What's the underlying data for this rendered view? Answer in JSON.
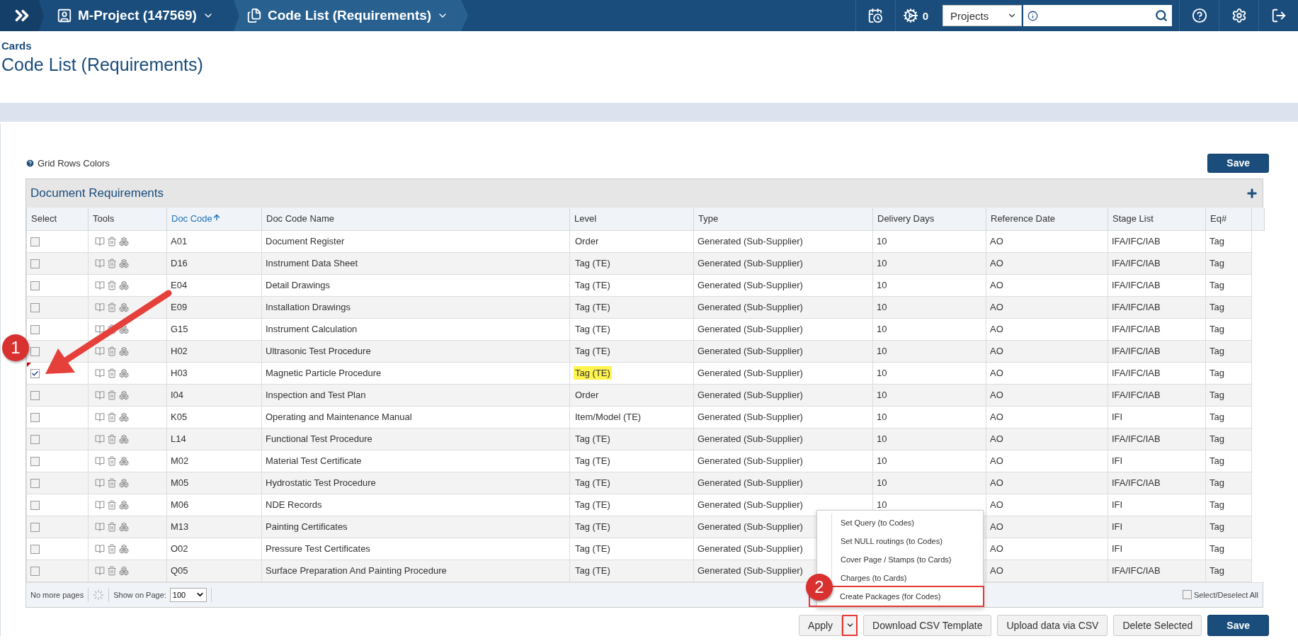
{
  "topbar": {
    "breadcrumbs": [
      {
        "label": "M-Project (147569)",
        "kind": "project"
      },
      {
        "label": "Code List (Requirements)",
        "kind": "page"
      }
    ],
    "jobs_count": "0",
    "search_scope": "Projects"
  },
  "header": {
    "section": "Cards",
    "title": "Code List (Requirements)"
  },
  "grid_colors_link": "Grid Rows Colors",
  "top_save": "Save",
  "grid": {
    "title": "Document Requirements",
    "columns": [
      {
        "label": "Select",
        "sorted": false
      },
      {
        "label": "Tools",
        "sorted": false
      },
      {
        "label": "Doc Code",
        "sorted": true
      },
      {
        "label": "Doc Code Name",
        "sorted": false
      },
      {
        "label": "Level",
        "sorted": false
      },
      {
        "label": "Type",
        "sorted": false
      },
      {
        "label": "Delivery Days",
        "sorted": false
      },
      {
        "label": "Reference Date",
        "sorted": false
      },
      {
        "label": "Stage List",
        "sorted": false
      },
      {
        "label": "Eq#",
        "sorted": false
      }
    ],
    "rows": [
      {
        "checked": false,
        "flagged": false,
        "code": "A01",
        "name": "Document Register",
        "level": "Order",
        "level_highlighted": false,
        "type": "Generated (Sub-Supplier)",
        "delivery_days": "10",
        "reference_date": "AO",
        "stage_list": "IFA/IFC/IAB",
        "eq": "Tag"
      },
      {
        "checked": false,
        "flagged": false,
        "code": "D16",
        "name": "Instrument Data Sheet",
        "level": "Tag (TE)",
        "level_highlighted": false,
        "type": "Generated (Sub-Supplier)",
        "delivery_days": "10",
        "reference_date": "AO",
        "stage_list": "IFA/IFC/IAB",
        "eq": "Tag"
      },
      {
        "checked": false,
        "flagged": false,
        "code": "E04",
        "name": "Detail Drawings",
        "level": "Tag (TE)",
        "level_highlighted": false,
        "type": "Generated (Sub-Supplier)",
        "delivery_days": "10",
        "reference_date": "AO",
        "stage_list": "IFA/IFC/IAB",
        "eq": "Tag"
      },
      {
        "checked": false,
        "flagged": false,
        "code": "E09",
        "name": "Installation Drawings",
        "level": "Tag (TE)",
        "level_highlighted": false,
        "type": "Generated (Sub-Supplier)",
        "delivery_days": "10",
        "reference_date": "AO",
        "stage_list": "IFA/IFC/IAB",
        "eq": "Tag"
      },
      {
        "checked": false,
        "flagged": false,
        "code": "G15",
        "name": "Instrument Calculation",
        "level": "Tag (TE)",
        "level_highlighted": false,
        "type": "Generated (Sub-Supplier)",
        "delivery_days": "10",
        "reference_date": "AO",
        "stage_list": "IFA/IFC/IAB",
        "eq": "Tag"
      },
      {
        "checked": false,
        "flagged": false,
        "code": "H02",
        "name": "Ultrasonic Test Procedure",
        "level": "Tag (TE)",
        "level_highlighted": false,
        "type": "Generated (Sub-Supplier)",
        "delivery_days": "10",
        "reference_date": "AO",
        "stage_list": "IFA/IFC/IAB",
        "eq": "Tag"
      },
      {
        "checked": true,
        "flagged": true,
        "code": "H03",
        "name": "Magnetic Particle Procedure",
        "level": "Tag (TE)",
        "level_highlighted": true,
        "type": "Generated (Sub-Supplier)",
        "delivery_days": "10",
        "reference_date": "AO",
        "stage_list": "IFA/IFC/IAB",
        "eq": "Tag"
      },
      {
        "checked": false,
        "flagged": false,
        "code": "I04",
        "name": "Inspection and Test Plan",
        "level": "Order",
        "level_highlighted": false,
        "type": "Generated (Sub-Supplier)",
        "delivery_days": "10",
        "reference_date": "AO",
        "stage_list": "IFA/IFC/IAB",
        "eq": "Tag"
      },
      {
        "checked": false,
        "flagged": false,
        "code": "K05",
        "name": "Operating and Maintenance Manual",
        "level": "Item/Model (TE)",
        "level_highlighted": false,
        "type": "Generated (Sub-Supplier)",
        "delivery_days": "10",
        "reference_date": "AO",
        "stage_list": "IFI",
        "eq": "Tag"
      },
      {
        "checked": false,
        "flagged": false,
        "code": "L14",
        "name": "Functional Test Procedure",
        "level": "Tag (TE)",
        "level_highlighted": false,
        "type": "Generated (Sub-Supplier)",
        "delivery_days": "10",
        "reference_date": "AO",
        "stage_list": "IFA/IFC/IAB",
        "eq": "Tag"
      },
      {
        "checked": false,
        "flagged": false,
        "code": "M02",
        "name": "Material Test Certificate",
        "level": "Tag (TE)",
        "level_highlighted": false,
        "type": "Generated (Sub-Supplier)",
        "delivery_days": "10",
        "reference_date": "AO",
        "stage_list": "IFI",
        "eq": "Tag"
      },
      {
        "checked": false,
        "flagged": false,
        "code": "M05",
        "name": "Hydrostatic Test Procedure",
        "level": "Tag (TE)",
        "level_highlighted": false,
        "type": "Generated (Sub-Supplier)",
        "delivery_days": "10",
        "reference_date": "AO",
        "stage_list": "IFA/IFC/IAB",
        "eq": "Tag"
      },
      {
        "checked": false,
        "flagged": false,
        "code": "M06",
        "name": "NDE Records",
        "level": "Tag (TE)",
        "level_highlighted": false,
        "type": "Generated (Sub-Supplier)",
        "delivery_days": "10",
        "reference_date": "AO",
        "stage_list": "IFI",
        "eq": "Tag"
      },
      {
        "checked": false,
        "flagged": false,
        "code": "M13",
        "name": "Painting Certificates",
        "level": "Tag (TE)",
        "level_highlighted": false,
        "type": "Generated (Sub-Supplier)",
        "reference_date": "AO",
        "stage_list": "IFI",
        "eq": "Tag"
      },
      {
        "checked": false,
        "flagged": false,
        "code": "O02",
        "name": "Pressure Test Certificates",
        "level": "Tag (TE)",
        "level_highlighted": false,
        "type": "Generated (Sub-Supplier)",
        "reference_date": "AO",
        "stage_list": "IFI",
        "eq": "Tag"
      },
      {
        "checked": false,
        "flagged": false,
        "code": "Q05",
        "name": "Surface Preparation And Painting Procedure",
        "level": "Tag (TE)",
        "level_highlighted": false,
        "type": "Generated (Sub-Supplier)",
        "reference_date": "AO",
        "stage_list": "IFA/IFC/IAB",
        "eq": "Tag"
      }
    ],
    "footer": {
      "paging": "No more pages",
      "page_size_label": "Show on Page:",
      "page_size": "100",
      "select_all_label": "Select/Deselect All",
      "select_all_checked": false
    }
  },
  "apply_menu": {
    "items": [
      {
        "label": "Set Query (to Codes)",
        "framed": false
      },
      {
        "label": "Set NULL routings (to Codes)",
        "framed": false
      },
      {
        "label": "Cover Page / Stamps (to Cards)",
        "framed": false
      },
      {
        "label": "Charges (to Cards)",
        "framed": false
      },
      {
        "label": "Create Packages (for Codes)",
        "framed": true
      }
    ]
  },
  "actions": [
    {
      "label": "Apply",
      "kind": "split"
    },
    {
      "label": "Download CSV Template",
      "kind": "plain"
    },
    {
      "label": "Upload data via CSV",
      "kind": "plain"
    },
    {
      "label": "Delete Selected",
      "kind": "plain"
    },
    {
      "label": "Save",
      "kind": "primary"
    }
  ],
  "annotations": [
    {
      "label": "1"
    },
    {
      "label": "2"
    }
  ]
}
